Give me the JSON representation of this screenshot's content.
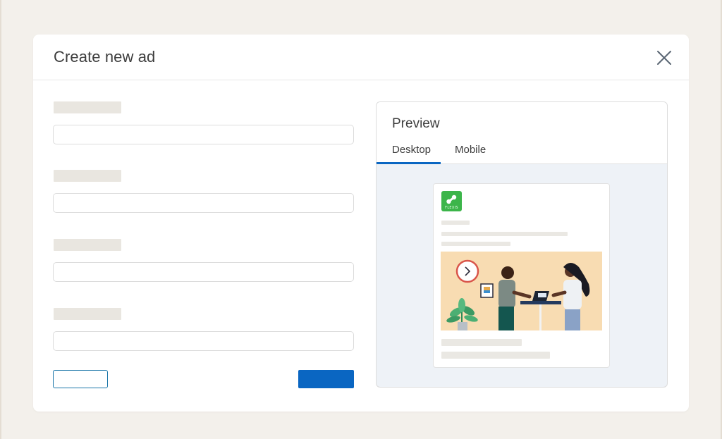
{
  "modal": {
    "title": "Create new ad"
  },
  "icons": {
    "close": "close-icon"
  },
  "colors": {
    "page_background": "#f3f0eb",
    "primary_button": "#0a66c2",
    "secondary_button_border": "#1a75a8",
    "logo_green": "#3cb54a",
    "preview_background": "#eef2f7"
  },
  "preview": {
    "title": "Preview",
    "tabs": [
      {
        "label": "Desktop",
        "active": true
      },
      {
        "label": "Mobile",
        "active": false
      }
    ],
    "ad": {
      "logo_text": "FLEXIS"
    }
  }
}
